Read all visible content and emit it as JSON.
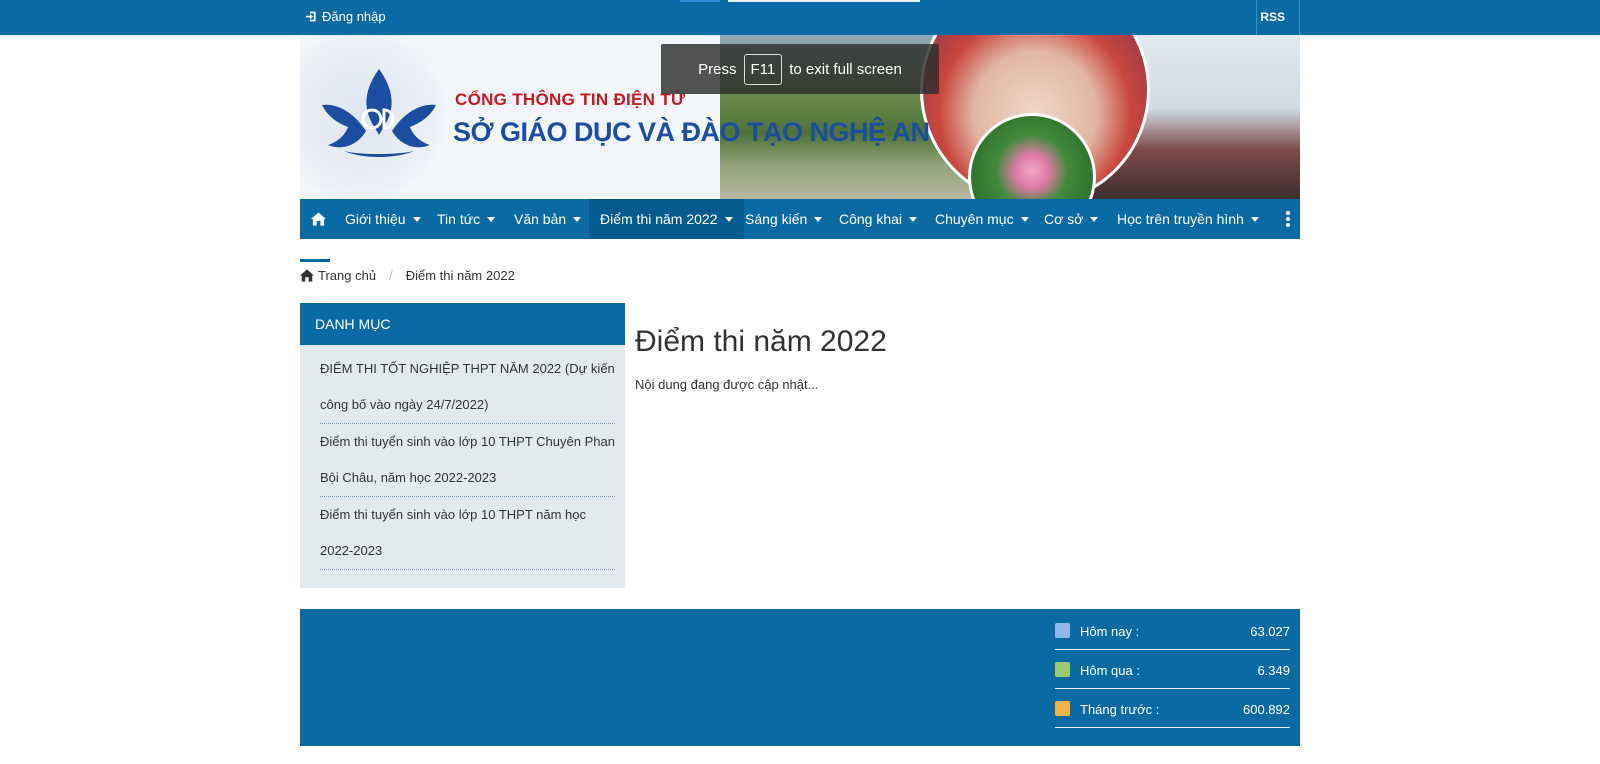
{
  "topbar": {
    "login_label": "Đăng nhập",
    "rss_label": "RSS"
  },
  "banner": {
    "title_line1": "CỔNG THÔNG TIN ĐIỆN TỬ",
    "title_line2": "SỞ GIÁO DỤC VÀ ĐÀO TẠO NGHỆ AN"
  },
  "fullscreen_notice": {
    "press": "Press",
    "key": "F11",
    "rest": "to exit full screen"
  },
  "nav": {
    "items": [
      {
        "label": "Giới thiệu"
      },
      {
        "label": "Tin tức"
      },
      {
        "label": "Văn bản"
      },
      {
        "label": "Điểm thi năm 2022"
      },
      {
        "label": "Sáng kiến"
      },
      {
        "label": "Công khai"
      },
      {
        "label": "Chuyên mục"
      },
      {
        "label": "Cơ sở"
      },
      {
        "label": "Học trên truyền hình"
      }
    ],
    "active_index": 3
  },
  "breadcrumb": {
    "home": "Trang chủ",
    "current": "Điểm thi năm 2022"
  },
  "sidebar": {
    "heading": "DANH MỤC",
    "items": [
      {
        "line1": "ĐIỂM THI TỐT NGHIỆP THPT NĂM 2022 (Dự kiến",
        "line2": "công bố vào ngày 24/7/2022)"
      },
      {
        "line1": "Điểm thi tuyển sinh vào lớp 10 THPT Chuyên Phan",
        "line2": "Bội Châu, năm học 2022-2023"
      },
      {
        "line1": "Điểm thi tuyển sinh vào lớp 10 THPT năm học",
        "line2": "2022-2023"
      }
    ]
  },
  "main": {
    "title": "Điểm thi năm 2022",
    "text": "Nội dung đang được cập nhật..."
  },
  "stats": [
    {
      "label": "Hôm nay :",
      "value": "63.027",
      "icon": "user-today-icon"
    },
    {
      "label": "Hôm qua :",
      "value": "6.349",
      "icon": "user-yesterday-icon"
    },
    {
      "label": "Tháng trước :",
      "value": "600.892",
      "icon": "user-month-icon"
    }
  ]
}
